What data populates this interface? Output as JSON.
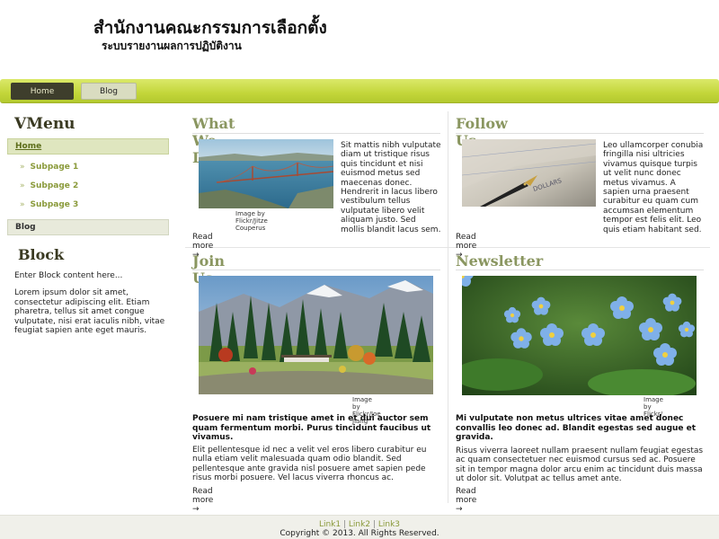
{
  "header": {
    "site_title": "สำนักงานคณะกรรมการเลือกตั้ง",
    "site_slogan": "ระบบรายงานผลการปฏิบัติงาน"
  },
  "nav": {
    "home_label": "Home",
    "blog_label": "Blog"
  },
  "sidebar": {
    "vmenu_title": "VMenu",
    "items": [
      {
        "label": "Home"
      },
      {
        "label": "Subpage 1"
      },
      {
        "label": "Subpage 2"
      },
      {
        "label": "Subpage 3"
      },
      {
        "label": "Blog"
      }
    ],
    "block_title": "Block",
    "block_text_1": "Enter Block content here...",
    "block_text_2": "Lorem ipsum dolor sit amet, consectetur adipiscing elit. Etiam pharetra, tellus sit amet congue vulputate, nisi erat iaculis nibh, vitae feugiat sapien ante eget mauris."
  },
  "content": {
    "what_we_do": {
      "title": "What We Do",
      "caption": "Image by Flickr/Jitze Couperus",
      "text": "Sit mattis nibh vulputate diam ut tristique risus quis tincidunt et nisi euismod metus sed maecenas donec. Hendrerit in lacus libero vestibulum tellus vulputate libero velit aliquam justo. Sed mollis blandit lacus sem.",
      "read_more": "Read more →"
    },
    "follow_us": {
      "title": "Follow Us",
      "text": "Leo ullamcorper conubia fringilla nisi ultricies vivamus quisque turpis ut velit nunc donec metus vivamus. A sapien urna praesent curabitur eu quam cum accumsan elementum tempor est felis elit. Leo quis etiam habitant sed.",
      "read_more": "Read more →"
    },
    "join_us": {
      "title": "Join Us",
      "caption": "Image by Flickr/Joe Jiang",
      "lead": "Posuere mi nam tristique amet in et dui auctor sem quam fermentum morbi. Purus tincidunt faucibus ut vivamus.",
      "text": "Elit pellentesque id nec a velit vel eros libero curabitur eu nulla etiam velit malesuada quam odio blandit. Sed pellentesque ante gravida nisl posuere amet sapien pede risus morbi posuere. Vel lacus viverra rhoncus ac.",
      "read_more": "Read more →"
    },
    "newsletter": {
      "title": "Newsletter",
      "caption": "Image by Flickr/",
      "lead": "Mi vulputate non metus ultrices vitae amet donec convallis leo donec ad. Blandit egestas sed augue et gravida.",
      "text": "Risus viverra laoreet nullam praesent nullam feugiat egestas ac quam consectetuer nec euismod cursus sed ac. Posuere sit in tempor magna dolor arcu enim ac tincidunt duis massa ut dolor sit. Volutpat ac tellus amet ante.",
      "read_more": "Read more →"
    }
  },
  "footer": {
    "links": [
      "Link1",
      "Link2",
      "Link3"
    ],
    "separator": "|",
    "copyright": "Copyright © 2013. All Rights Reserved."
  },
  "colors": {
    "nav_bar": "#c3d63a",
    "nav_active": "#3e3e2c",
    "heading_olive": "#8a9660",
    "sidebar_title": "#3a3a22",
    "submenu_link": "#8a9a3a"
  }
}
